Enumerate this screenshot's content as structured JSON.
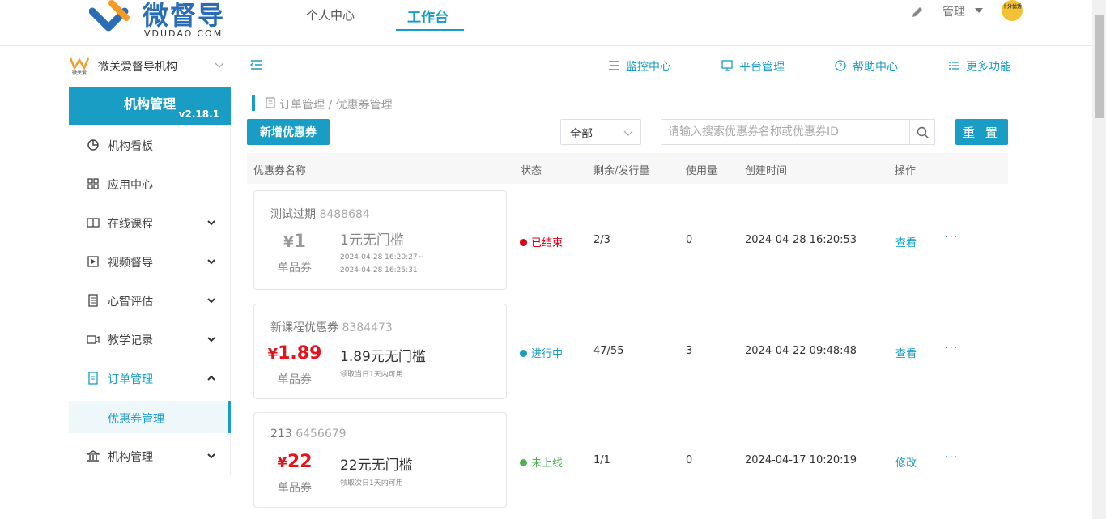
{
  "header": {
    "brand": "微督导",
    "brand_sub": "VDUDAO.COM",
    "tabs": [
      {
        "label": "个人中心"
      },
      {
        "label": "工作台"
      }
    ],
    "admin_label": "管理",
    "avatar_text": "十分优秀"
  },
  "sidebar": {
    "org_name": "微关爱督导机构",
    "org_logo_text": "微关爱",
    "title": "机构管理",
    "version": "v2.18.1",
    "items": [
      {
        "label": "机构看板",
        "icon": "pie-chart-icon"
      },
      {
        "label": "应用中心",
        "icon": "grid-icon"
      },
      {
        "label": "在线课程",
        "icon": "book-icon"
      },
      {
        "label": "视频督导",
        "icon": "play-icon"
      },
      {
        "label": "心智评估",
        "icon": "document-icon"
      },
      {
        "label": "教学记录",
        "icon": "video-camera-icon"
      },
      {
        "label": "订单管理",
        "icon": "receipt-icon"
      },
      {
        "label": "机构管理",
        "icon": "bank-icon"
      }
    ],
    "sub_item": "优惠券管理"
  },
  "toolbar": {
    "links": [
      {
        "label": "监控中心",
        "icon": "monitor-list-icon"
      },
      {
        "label": "平台管理",
        "icon": "desktop-icon"
      },
      {
        "label": "帮助中心",
        "icon": "help-circle-icon"
      },
      {
        "label": "更多功能",
        "icon": "list-icon"
      }
    ]
  },
  "breadcrumb": "订单管理 / 优惠券管理",
  "filters": {
    "add_button": "新增优惠券",
    "status_selected": "全部",
    "search_placeholder": "请输入搜索优惠券名称或优惠券ID",
    "reset_button": "重 置"
  },
  "table": {
    "columns": [
      "优惠券名称",
      "状态",
      "剩余/发行量",
      "使用量",
      "创建时间",
      "操作"
    ],
    "rows": [
      {
        "name": "测试过期",
        "id": "8488684",
        "yen": "¥",
        "price": "1",
        "type": "单品券",
        "condition": "1元无门槛",
        "note1": "2024-04-28 16:20:27~",
        "note2": "2024-04-28 16:25:31",
        "status": "已结束",
        "status_color": "#d9001b",
        "remaining": "2/3",
        "used": "0",
        "created": "2024-04-28 16:20:53",
        "action": "查看",
        "more": "···"
      },
      {
        "name": "新课程优惠券",
        "id": "8384473",
        "yen": "¥",
        "price": "1.89",
        "type": "单品券",
        "condition": "1.89元无门槛",
        "note1": "领取当日1天内可用",
        "status": "进行中",
        "status_color": "#1a9dc4",
        "remaining": "47/55",
        "used": "3",
        "created": "2024-04-22 09:48:48",
        "action": "查看",
        "more": "···"
      },
      {
        "name": "213",
        "id": "6456679",
        "yen": "¥",
        "price": "22",
        "type": "单品券",
        "condition": "22元无门槛",
        "note1": "领取次日1天内可用",
        "status": "未上线",
        "status_color": "#4caf50",
        "remaining": "1/1",
        "used": "0",
        "created": "2024-04-17 10:20:19",
        "action": "修改",
        "more": "···"
      }
    ]
  }
}
